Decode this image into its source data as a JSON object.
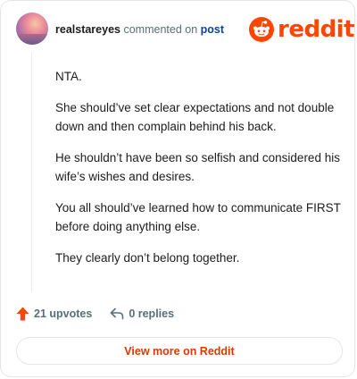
{
  "comment": {
    "author": "realstareyes",
    "verb": "commented on",
    "target": "post",
    "paragraphs": [
      "NTA.",
      "She should’ve set clear expectations and not double down and then complain behind his back.",
      "He shouldn’t have been so selfish and considered his wife’s wishes and desires.",
      "You all should’ve learned how to communicate FIRST before doing anything else.",
      "They clearly don’t belong together."
    ],
    "upvotes_label": "21 upvotes",
    "replies_label": "0 replies"
  },
  "brand": {
    "wordmark": "reddit",
    "accent_color": "#ff4500"
  },
  "footer": {
    "view_more_label": "View more on Reddit"
  },
  "icons": {
    "logo": "reddit-snoo-icon",
    "upvote": "upvote-arrow-icon",
    "reply": "reply-arrow-icon"
  }
}
